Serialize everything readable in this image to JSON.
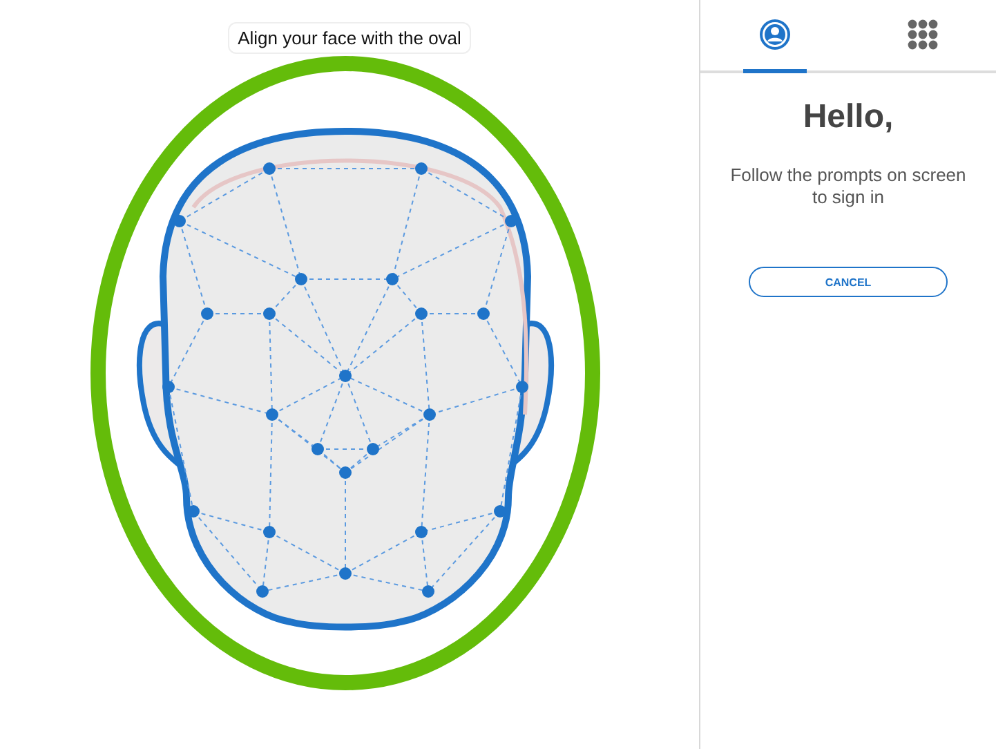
{
  "prompt": "Align your face with the oval",
  "tabs": [
    {
      "kind": "person",
      "selected": true
    },
    {
      "kind": "keypad",
      "selected": false
    }
  ],
  "greeting": "Hello,",
  "instructions": "Follow the prompts on screen to sign in",
  "cancel_button": "CANCEL"
}
